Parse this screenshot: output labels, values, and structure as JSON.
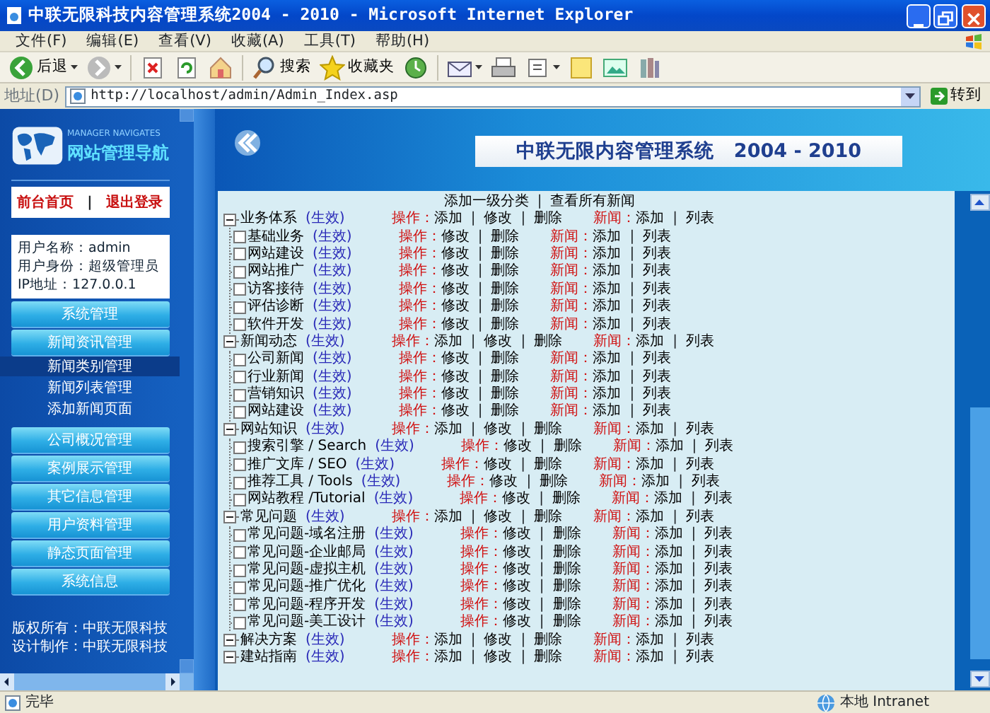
{
  "window": {
    "title": "中联无限科技内容管理系统2004 - 2010 - Microsoft Internet Explorer"
  },
  "menu": [
    "文件(F)",
    "编辑(E)",
    "查看(V)",
    "收藏(A)",
    "工具(T)",
    "帮助(H)"
  ],
  "toolbar": [
    {
      "kind": "back",
      "label": "后退",
      "dropdown": true
    },
    {
      "kind": "forward",
      "dropdown": true
    },
    {
      "kind": "separator"
    },
    {
      "kind": "stop",
      "dropdown": false
    },
    {
      "kind": "refresh",
      "dropdown": false
    },
    {
      "kind": "home",
      "dropdown": false
    },
    {
      "kind": "separator"
    },
    {
      "kind": "search",
      "label": "搜索",
      "dropdown": false
    },
    {
      "kind": "favorites",
      "label": "收藏夹",
      "dropdown": false
    },
    {
      "kind": "history",
      "dropdown": false
    },
    {
      "kind": "separator"
    },
    {
      "kind": "mail",
      "dropdown": true
    },
    {
      "kind": "print",
      "dropdown": false
    },
    {
      "kind": "edit",
      "dropdown": true
    },
    {
      "kind": "note",
      "dropdown": false
    },
    {
      "kind": "messenger",
      "dropdown": false
    },
    {
      "kind": "research",
      "dropdown": false
    }
  ],
  "address": {
    "label": "地址(D)",
    "value": "http://localhost/admin/Admin_Index.asp",
    "go": "转到"
  },
  "sidebar": {
    "subtitle": "MANAGER NAVIGATES",
    "title": "网站管理导航",
    "links": [
      "前台首页",
      "退出登录"
    ],
    "link_separator": "|",
    "user": [
      "用户名称：admin",
      "用户身份：超级管理员",
      "IP地址：127.0.0.1"
    ],
    "nav": [
      {
        "kind": "section",
        "label": "系统管理"
      },
      {
        "kind": "section",
        "label": "新闻资讯管理"
      },
      {
        "kind": "sub",
        "label": "新闻类别管理",
        "selected": true
      },
      {
        "kind": "sub",
        "label": "新闻列表管理",
        "selected": false
      },
      {
        "kind": "sub",
        "label": "添加新闻页面",
        "selected": false
      },
      {
        "kind": "section",
        "label": "公司概况管理"
      },
      {
        "kind": "section",
        "label": "案例展示管理"
      },
      {
        "kind": "section",
        "label": "其它信息管理"
      },
      {
        "kind": "section",
        "label": "用户资料管理"
      },
      {
        "kind": "section",
        "label": "静态页面管理"
      },
      {
        "kind": "section",
        "label": "系统信息"
      }
    ],
    "footer": [
      "版权所有：中联无限科技",
      "设计制作：中联无限科技"
    ]
  },
  "banner": {
    "title": "中联无限内容管理系统　2004 - 2010"
  },
  "top_actions": [
    "添加一级分类",
    "查看所有新闻"
  ],
  "tree": {
    "separator": "|",
    "nodes": [
      {
        "name": "业务体系",
        "status": "(生效)",
        "expanded": true,
        "actions": [
          {
            "label": "操作：",
            "links": [
              "添加",
              "修改",
              "删除"
            ]
          },
          {
            "label": "新闻：",
            "links": [
              "添加",
              "列表"
            ]
          }
        ],
        "children": [
          {
            "name": "基础业务",
            "status": "(生效)",
            "actions": [
              {
                "label": "操作：",
                "links": [
                  "修改",
                  "删除"
                ]
              },
              {
                "label": "新闻：",
                "links": [
                  "添加",
                  "列表"
                ]
              }
            ]
          },
          {
            "name": "网站建设",
            "status": "(生效)",
            "actions": [
              {
                "label": "操作：",
                "links": [
                  "修改",
                  "删除"
                ]
              },
              {
                "label": "新闻：",
                "links": [
                  "添加",
                  "列表"
                ]
              }
            ]
          },
          {
            "name": "网站推广",
            "status": "(生效)",
            "actions": [
              {
                "label": "操作：",
                "links": [
                  "修改",
                  "删除"
                ]
              },
              {
                "label": "新闻：",
                "links": [
                  "添加",
                  "列表"
                ]
              }
            ]
          },
          {
            "name": "访客接待",
            "status": "(生效)",
            "actions": [
              {
                "label": "操作：",
                "links": [
                  "修改",
                  "删除"
                ]
              },
              {
                "label": "新闻：",
                "links": [
                  "添加",
                  "列表"
                ]
              }
            ]
          },
          {
            "name": "评估诊断",
            "status": "(生效)",
            "actions": [
              {
                "label": "操作：",
                "links": [
                  "修改",
                  "删除"
                ]
              },
              {
                "label": "新闻：",
                "links": [
                  "添加",
                  "列表"
                ]
              }
            ]
          },
          {
            "name": "软件开发",
            "status": "(生效)",
            "actions": [
              {
                "label": "操作：",
                "links": [
                  "修改",
                  "删除"
                ]
              },
              {
                "label": "新闻：",
                "links": [
                  "添加",
                  "列表"
                ]
              }
            ]
          }
        ]
      },
      {
        "name": "新闻动态",
        "status": "(生效)",
        "expanded": true,
        "actions": [
          {
            "label": "操作：",
            "links": [
              "添加",
              "修改",
              "删除"
            ]
          },
          {
            "label": "新闻：",
            "links": [
              "添加",
              "列表"
            ]
          }
        ],
        "children": [
          {
            "name": "公司新闻",
            "status": "(生效)",
            "actions": [
              {
                "label": "操作：",
                "links": [
                  "修改",
                  "删除"
                ]
              },
              {
                "label": "新闻：",
                "links": [
                  "添加",
                  "列表"
                ]
              }
            ]
          },
          {
            "name": "行业新闻",
            "status": "(生效)",
            "actions": [
              {
                "label": "操作：",
                "links": [
                  "修改",
                  "删除"
                ]
              },
              {
                "label": "新闻：",
                "links": [
                  "添加",
                  "列表"
                ]
              }
            ]
          },
          {
            "name": "营销知识",
            "status": "(生效)",
            "actions": [
              {
                "label": "操作：",
                "links": [
                  "修改",
                  "删除"
                ]
              },
              {
                "label": "新闻：",
                "links": [
                  "添加",
                  "列表"
                ]
              }
            ]
          },
          {
            "name": "网站建设",
            "status": "(生效)",
            "actions": [
              {
                "label": "操作：",
                "links": [
                  "修改",
                  "删除"
                ]
              },
              {
                "label": "新闻：",
                "links": [
                  "添加",
                  "列表"
                ]
              }
            ]
          }
        ]
      },
      {
        "name": "网站知识",
        "status": "(生效)",
        "expanded": true,
        "actions": [
          {
            "label": "操作：",
            "links": [
              "添加",
              "修改",
              "删除"
            ]
          },
          {
            "label": "新闻：",
            "links": [
              "添加",
              "列表"
            ]
          }
        ],
        "children": [
          {
            "name": "搜索引擎 / Search",
            "status": "(生效)",
            "actions": [
              {
                "label": "操作：",
                "links": [
                  "修改",
                  "删除"
                ]
              },
              {
                "label": "新闻：",
                "links": [
                  "添加",
                  "列表"
                ]
              }
            ]
          },
          {
            "name": "推广文库 / SEO",
            "status": "(生效)",
            "actions": [
              {
                "label": "操作：",
                "links": [
                  "修改",
                  "删除"
                ]
              },
              {
                "label": "新闻：",
                "links": [
                  "添加",
                  "列表"
                ]
              }
            ]
          },
          {
            "name": "推荐工具 / Tools",
            "status": "(生效)",
            "actions": [
              {
                "label": "操作：",
                "links": [
                  "修改",
                  "删除"
                ]
              },
              {
                "label": "新闻：",
                "links": [
                  "添加",
                  "列表"
                ]
              }
            ]
          },
          {
            "name": "网站教程 /Tutorial",
            "status": "(生效)",
            "actions": [
              {
                "label": "操作：",
                "links": [
                  "修改",
                  "删除"
                ]
              },
              {
                "label": "新闻：",
                "links": [
                  "添加",
                  "列表"
                ]
              }
            ]
          }
        ]
      },
      {
        "name": "常见问题",
        "status": "(生效)",
        "expanded": true,
        "actions": [
          {
            "label": "操作：",
            "links": [
              "添加",
              "修改",
              "删除"
            ]
          },
          {
            "label": "新闻：",
            "links": [
              "添加",
              "列表"
            ]
          }
        ],
        "children": [
          {
            "name": "常见问题-域名注册",
            "status": "(生效)",
            "actions": [
              {
                "label": "操作：",
                "links": [
                  "修改",
                  "删除"
                ]
              },
              {
                "label": "新闻：",
                "links": [
                  "添加",
                  "列表"
                ]
              }
            ]
          },
          {
            "name": "常见问题-企业邮局",
            "status": "(生效)",
            "actions": [
              {
                "label": "操作：",
                "links": [
                  "修改",
                  "删除"
                ]
              },
              {
                "label": "新闻：",
                "links": [
                  "添加",
                  "列表"
                ]
              }
            ]
          },
          {
            "name": "常见问题-虚拟主机",
            "status": "(生效)",
            "actions": [
              {
                "label": "操作：",
                "links": [
                  "修改",
                  "删除"
                ]
              },
              {
                "label": "新闻：",
                "links": [
                  "添加",
                  "列表"
                ]
              }
            ]
          },
          {
            "name": "常见问题-推广优化",
            "status": "(生效)",
            "actions": [
              {
                "label": "操作：",
                "links": [
                  "修改",
                  "删除"
                ]
              },
              {
                "label": "新闻：",
                "links": [
                  "添加",
                  "列表"
                ]
              }
            ]
          },
          {
            "name": "常见问题-程序开发",
            "status": "(生效)",
            "actions": [
              {
                "label": "操作：",
                "links": [
                  "修改",
                  "删除"
                ]
              },
              {
                "label": "新闻：",
                "links": [
                  "添加",
                  "列表"
                ]
              }
            ]
          },
          {
            "name": "常见问题-美工设计",
            "status": "(生效)",
            "actions": [
              {
                "label": "操作：",
                "links": [
                  "修改",
                  "删除"
                ]
              },
              {
                "label": "新闻：",
                "links": [
                  "添加",
                  "列表"
                ]
              }
            ]
          }
        ]
      },
      {
        "name": "解决方案",
        "status": "(生效)",
        "expanded": true,
        "actions": [
          {
            "label": "操作：",
            "links": [
              "添加",
              "修改",
              "删除"
            ]
          },
          {
            "label": "新闻：",
            "links": [
              "添加",
              "列表"
            ]
          }
        ]
      },
      {
        "name": "建站指南",
        "status": "(生效)",
        "expanded": true,
        "actions": [
          {
            "label": "操作：",
            "links": [
              "添加",
              "修改",
              "删除"
            ]
          },
          {
            "label": "新闻：",
            "links": [
              "添加",
              "列表"
            ]
          }
        ]
      }
    ]
  },
  "status_bar": {
    "text": "完毕",
    "zone": "本地 Intranet"
  }
}
